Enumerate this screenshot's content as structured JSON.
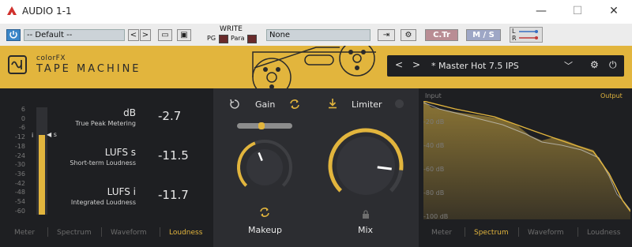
{
  "window": {
    "title": "AUDIO 1-1",
    "minimize": "—",
    "maximize": "☐",
    "close": "✕"
  },
  "host": {
    "preset": "-- Default --",
    "write": "WRITE",
    "pg": "PG",
    "para": "Para",
    "automation": "None",
    "ctr": "C.Tr",
    "ms": "M / S",
    "l": "L",
    "r": "R"
  },
  "plugin": {
    "brand_small": "colorFX",
    "brand_big": "TAPE MACHINE",
    "preset_name": "* Master Hot 7.5 IPS",
    "accent": "#e2b53d"
  },
  "loudness": {
    "scale": [
      "6",
      "0",
      "-6",
      "-12",
      "-18",
      "-24",
      "-30",
      "-36",
      "-42",
      "-48",
      "-54",
      "-60"
    ],
    "marker_i": "i",
    "marker_s": "s",
    "level_fraction": 0.74,
    "rows": [
      {
        "label": "dB",
        "sub": "True Peak Metering",
        "value": "-2.7"
      },
      {
        "label": "LUFS s",
        "sub": "Short-term Loudness",
        "value": "-11.5"
      },
      {
        "label": "LUFS i",
        "sub": "Integrated Loudness",
        "value": "-11.7"
      }
    ],
    "tabs": [
      "Meter",
      "Spectrum",
      "Waveform",
      "Loudness"
    ],
    "active_tab": "Loudness"
  },
  "controls": {
    "gain": "Gain",
    "limiter": "Limiter",
    "makeup": "Makeup",
    "mix": "Mix",
    "makeup_level": 0.42,
    "mix_level": 0.86
  },
  "spectrum": {
    "input": "Input",
    "output": "Output",
    "db_labels": [
      "-20 dB",
      "-40 dB",
      "-60 dB",
      "-80 dB",
      "-100 dB"
    ],
    "tabs": [
      "Meter",
      "Spectrum",
      "Waveform",
      "Loudness"
    ],
    "active_tab": "Spectrum"
  }
}
